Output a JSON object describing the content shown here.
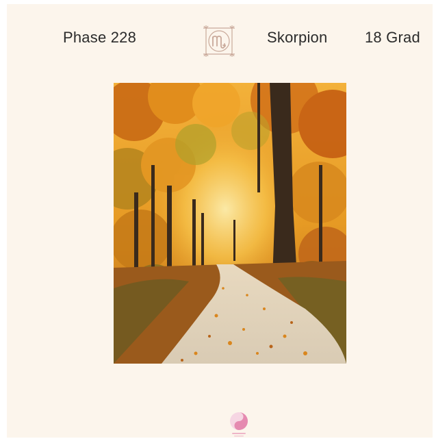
{
  "header": {
    "phase": "Phase 228",
    "sign": "Skorpion",
    "degree": "18 Grad"
  },
  "emblem": {
    "icon": "scorpio-glyph-icon",
    "color": "#c9a99a"
  },
  "photo": {
    "subject": "autumn-forest-path"
  },
  "brand_logo": {
    "icon": "brand-swirl-logo",
    "color": "#e58ab0"
  },
  "colors": {
    "background": "#fcf5ec",
    "text": "#2b2b2b",
    "emblem": "#c9a99a",
    "logo": "#e58ab0"
  }
}
